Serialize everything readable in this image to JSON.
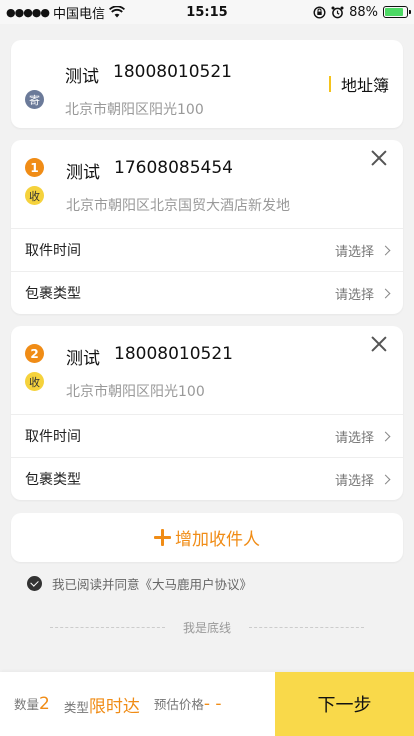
{
  "status_bar": {
    "carrier": "中国电信",
    "time": "15:15",
    "battery": "88%",
    "battery_level": 0.88
  },
  "sender": {
    "badge": "寄",
    "name": "测试",
    "phone": "18008010521",
    "address": "北京市朝阳区阳光100",
    "address_book_label": "地址簿"
  },
  "receivers": [
    {
      "index": "1",
      "badge": "收",
      "name": "测试",
      "phone": "17608085454",
      "address": "北京市朝阳区北京国贸大酒店新发地",
      "pickup_label": "取件时间",
      "pickup_value": "请选择",
      "package_label": "包裹类型",
      "package_value": "请选择"
    },
    {
      "index": "2",
      "badge": "收",
      "name": "测试",
      "phone": "18008010521",
      "address": "北京市朝阳区阳光100",
      "pickup_label": "取件时间",
      "pickup_value": "请选择",
      "package_label": "包裹类型",
      "package_value": "请选择"
    }
  ],
  "add_receiver_label": "增加收件人",
  "agreement_text": "我已阅读并同意《大马鹿用户协议》",
  "bottom_text": "我是底线",
  "footer": {
    "quantity_label": "数量",
    "quantity_value": "2",
    "type_label": "类型",
    "type_value": "限时达",
    "price_label": "预估价格",
    "price_value": "- -",
    "next_label": "下一步"
  },
  "colors": {
    "accent": "#f08c16",
    "primary_button": "#f9d94a",
    "background": "#f2f2f2"
  }
}
